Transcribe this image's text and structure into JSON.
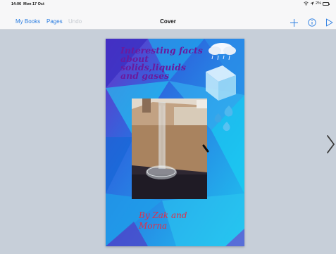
{
  "status_bar": {
    "time": "14:06",
    "date": "Mon 17 Oct",
    "battery": "2%"
  },
  "toolbar": {
    "my_books_label": "My Books",
    "pages_label": "Pages",
    "undo_label": "Undo",
    "title": "Cover",
    "icons": [
      "add-icon",
      "info-icon",
      "play-icon"
    ],
    "accent_color": "#2a7de1"
  },
  "cover": {
    "title": "Interesting facts\nabout solids,liquids\nand gases",
    "author": "By Zak and\nMorna",
    "title_color": "#6a1a9e",
    "author_color": "#e32e46",
    "background_colors": [
      "#1fc7f0",
      "#2a6ee0",
      "#6b2fc8"
    ]
  },
  "navigation": {
    "next_icon": "chevron-right-icon"
  }
}
